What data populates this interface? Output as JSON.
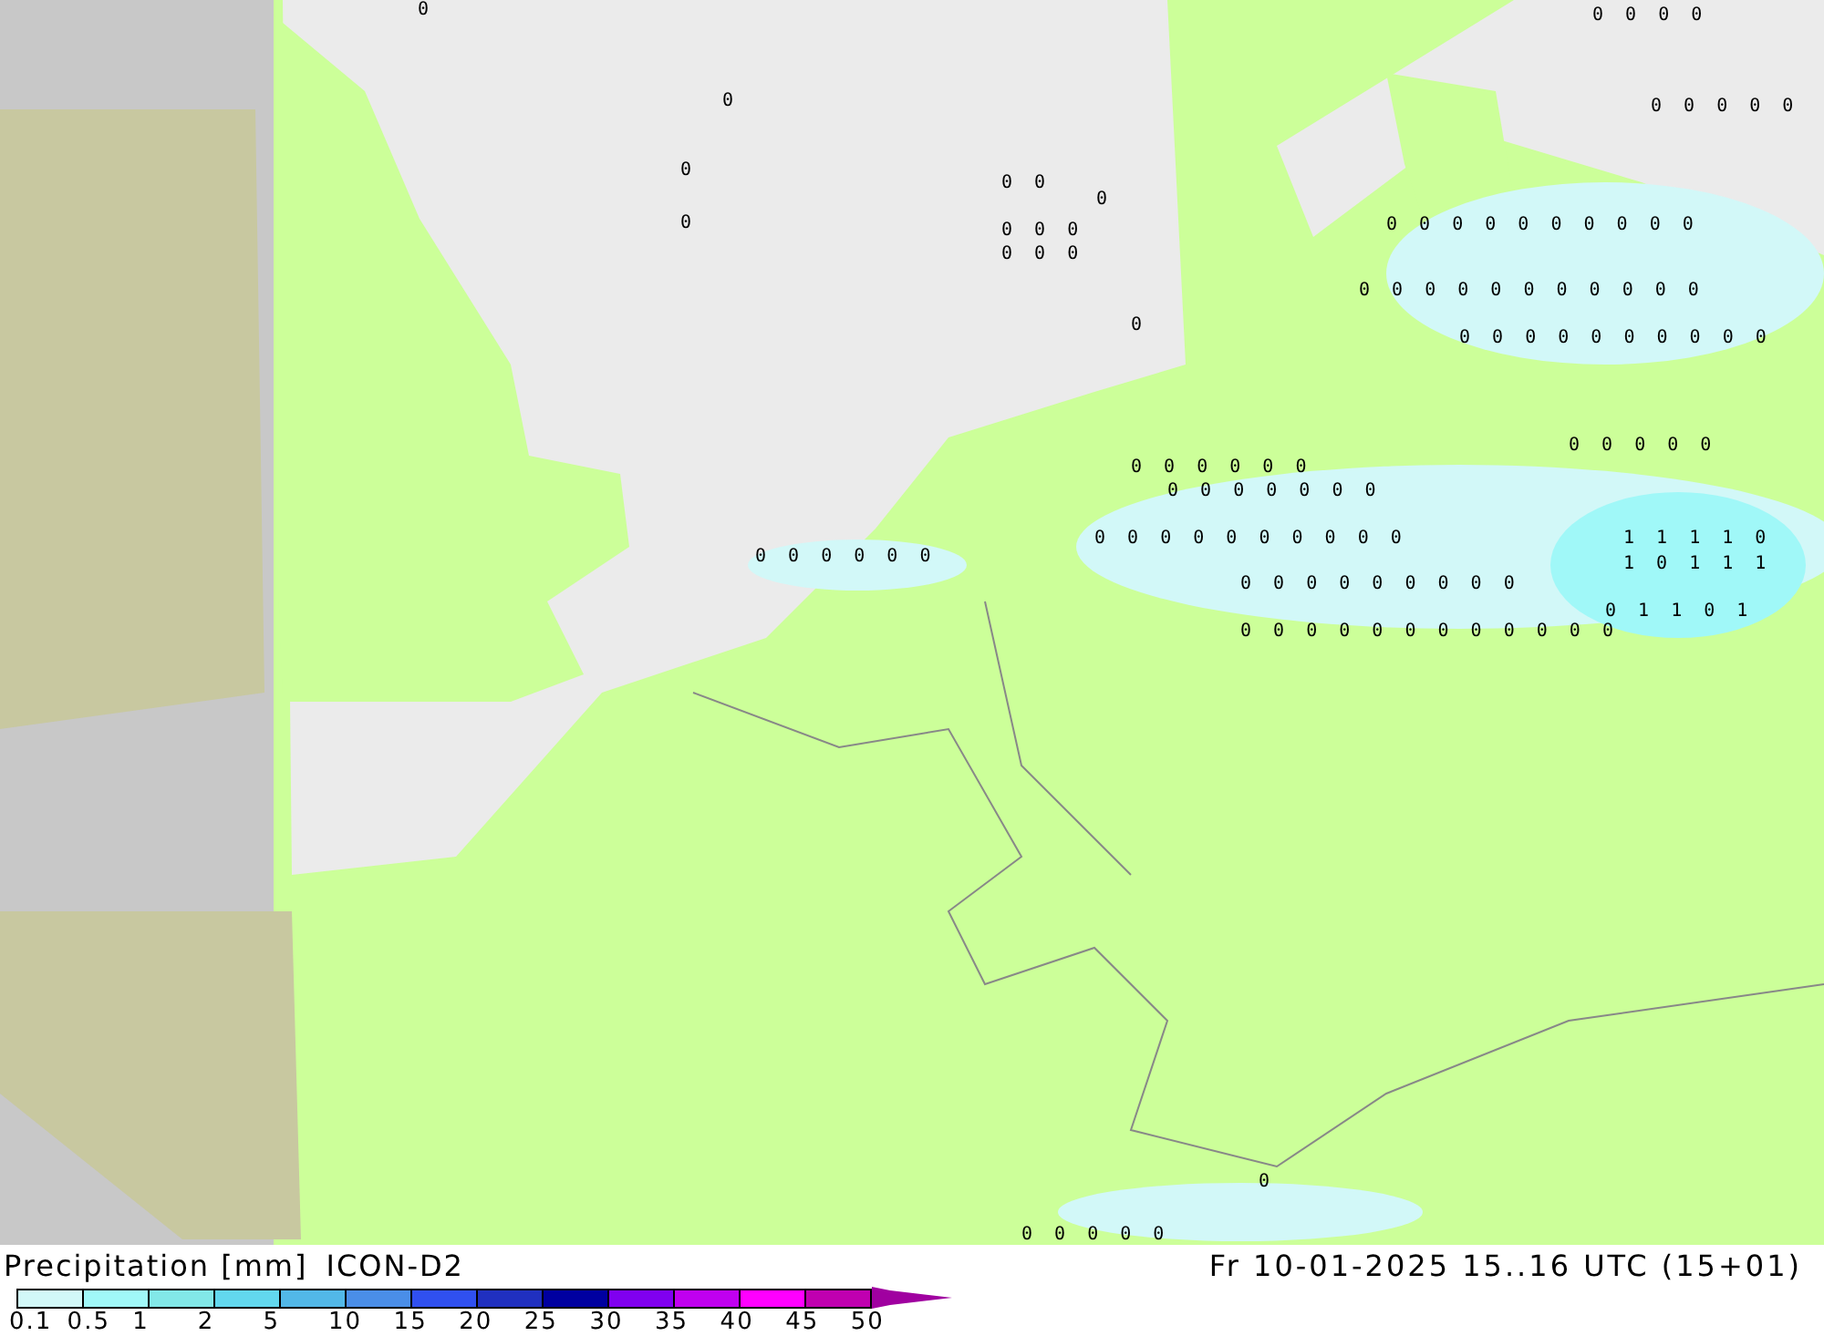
{
  "map": {
    "labels": [
      "0",
      "0 0 0 0",
      "0",
      "0 0 0 0 0",
      "0",
      "0 0",
      "0",
      "0",
      "0 0 0",
      "0 0 0 0 0 0 0 0 0 0",
      "0 0 0",
      "0 0 0 0 0 0 0 0 0 0 0",
      "0",
      "0 0 0 0 0 0 0 0 0 0",
      "0 0 0 0 0",
      "0 0 0 0 0 0",
      "0 0 0 0 0 0 0",
      "0 0 0 0 0 0 0 0 0 0",
      "1 1 1 1 0",
      "0 0 0 0 0 0",
      "1 0 1 1 1",
      "0 0 0 0 0 0 0 0 0",
      "0 1 1 0 1",
      "0 0 0 0 0 0 0 0 0 0 0 0",
      "0",
      "0 0 0 0 0"
    ]
  },
  "legend": {
    "title": "Precipitation [mm]",
    "model": "ICON-D2",
    "bins": [
      {
        "color": "#d2f8f8"
      },
      {
        "color": "#a0f8f8"
      },
      {
        "color": "#82e8e8"
      },
      {
        "color": "#62d8ee"
      },
      {
        "color": "#52b8e8"
      },
      {
        "color": "#4a8ee8"
      },
      {
        "color": "#3050f0"
      },
      {
        "color": "#2030c0"
      },
      {
        "color": "#0000a0"
      },
      {
        "color": "#8000f0"
      },
      {
        "color": "#c000f0"
      },
      {
        "color": "#ff00ff"
      },
      {
        "color": "#c000b0"
      },
      {
        "kind": "arrow",
        "color": "#a000a0"
      }
    ],
    "ticks": [
      "0.1",
      "0.5",
      "1",
      "2",
      "5",
      "10",
      "15",
      "20",
      "25",
      "30",
      "35",
      "40",
      "45",
      "50"
    ]
  },
  "valid_time": "Fr 10-01-2025 15..16 UTC (15+01)"
}
